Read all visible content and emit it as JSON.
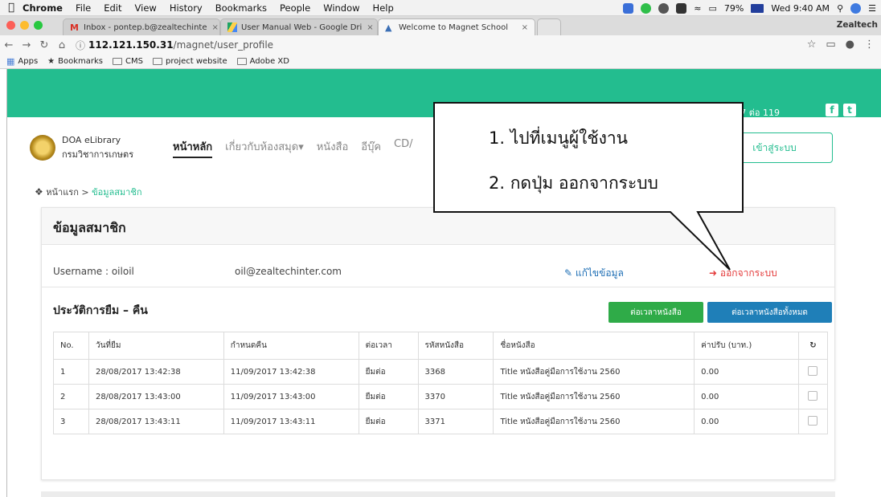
{
  "menubar": {
    "app": "Chrome",
    "items": [
      "File",
      "Edit",
      "View",
      "History",
      "Bookmarks",
      "People",
      "Window",
      "Help"
    ],
    "battery": "79%",
    "clock": "Wed 9:40 AM"
  },
  "tabs": [
    {
      "label": "Inbox - pontep.b@zealtechinte",
      "close": "×"
    },
    {
      "label": "User Manual Web - Google Dri",
      "close": "×"
    },
    {
      "label": "Welcome to Magnet School",
      "close": "×"
    }
  ],
  "profile": "Zealtech",
  "address": {
    "host": "112.121.150.31",
    "path": "/magnet/user_profile"
  },
  "bookmarks": [
    "Apps",
    "Bookmarks",
    "CMS",
    "project website",
    "Adobe XD"
  ],
  "site": {
    "phone": "0151-7 ต่อ 119",
    "facebook": "f",
    "twitter": "t",
    "logo_en": "DOA eLibrary",
    "logo_th": "กรมวิชาการเกษตร",
    "nav": [
      "หน้าหลัก",
      "เกี่ยวกับห้องสมุด▾",
      "หนังสือ",
      "อีบุ๊ค",
      "CD/"
    ],
    "login": "เข้าสู่ระบบ",
    "breadcrumb": {
      "home": "หน้าแรก",
      "sep": ">",
      "current": "ข้อมูลสมาชิก"
    },
    "card_title": "ข้อมูลสมาชิก",
    "username": "Username : oiloil",
    "email": "oil@zealtechinter.com",
    "edit": "แก้ไขข้อมูล",
    "logout": "ออกจากระบบ",
    "history_title": "ประวัติการยืม – คืน",
    "btn_extend": "ต่อเวลาหนังสือ",
    "btn_extend_all": "ต่อเวลาหนังสือทั้งหมด",
    "table": {
      "headers": [
        "No.",
        "วันที่ยืม",
        "กำหนดคืน",
        "ต่อเวลา",
        "รหัสหนังสือ",
        "ชื่อหนังสือ",
        "ค่าปรับ (บาท.)",
        "↻"
      ],
      "rows": [
        [
          "1",
          "28/08/2017 13:42:38",
          "11/09/2017 13:42:38",
          "ยืมต่อ",
          "3368",
          "Title หนังสือคู่มือการใช้งาน 2560",
          "0.00"
        ],
        [
          "2",
          "28/08/2017 13:43:00",
          "11/09/2017 13:43:00",
          "ยืมต่อ",
          "3370",
          "Title หนังสือคู่มือการใช้งาน 2560",
          "0.00"
        ],
        [
          "3",
          "28/08/2017 13:43:11",
          "11/09/2017 13:43:11",
          "ยืมต่อ",
          "3371",
          "Title หนังสือคู่มือการใช้งาน 2560",
          "0.00"
        ]
      ]
    }
  },
  "callout": {
    "line1": "1.  ไปที่เมนูผู้ใช้งาน",
    "line2": "2.  กดปุ่ม ออกจากระบบ"
  },
  "colors": {
    "brand_green": "#23bd8f",
    "link_blue": "#1f6fb5",
    "logout_red": "#e43c3c",
    "btn_green": "#2fab48",
    "btn_blue": "#1f7fb8"
  }
}
